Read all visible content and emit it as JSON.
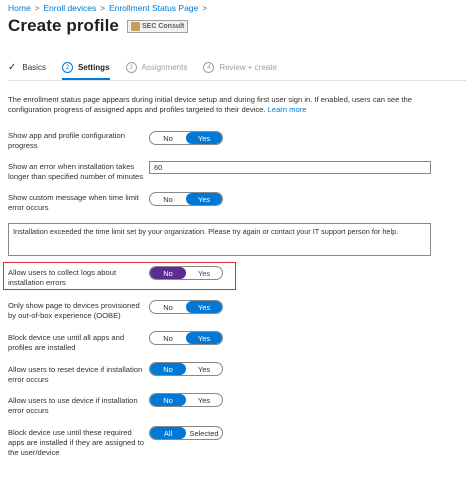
{
  "breadcrumb": [
    {
      "label": "Home"
    },
    {
      "label": "Enroll devices"
    },
    {
      "label": "Enrollment Status Page"
    }
  ],
  "header": {
    "title": "Create profile",
    "badge": "SEC Consult"
  },
  "steps": [
    {
      "label": "Basics",
      "status": "done"
    },
    {
      "num": "2",
      "label": "Settings",
      "status": "active"
    },
    {
      "num": "3",
      "label": "Assignments",
      "status": "inactive"
    },
    {
      "num": "4",
      "label": "Review + create",
      "status": "inactive"
    }
  ],
  "description": {
    "text": "The enrollment status page appears during initial device setup and during first user sign in. If enabled, users can see the configuration progress of assigned apps and profiles targeted to their device.",
    "link": "Learn more"
  },
  "settings": {
    "show_progress": {
      "label": "Show app and profile configuration progress",
      "options": [
        "No",
        "Yes"
      ],
      "selected": "Yes"
    },
    "error_timeout": {
      "label": "Show an error when installation takes longer than specified number of minutes",
      "value": "60"
    },
    "custom_message": {
      "label": "Show custom message when time limit error occurs",
      "options": [
        "No",
        "Yes"
      ],
      "selected": "Yes"
    },
    "message_text": "Installation exceeded the time limit set by your organization. Please try again or contact your IT support person for help.",
    "collect_logs": {
      "label": "Allow users to collect logs about installation errors",
      "options": [
        "No",
        "Yes"
      ],
      "selected": "No"
    },
    "oobe_only": {
      "label": "Only show page to devices provisioned by out-of-box experience (OOBE)",
      "options": [
        "No",
        "Yes"
      ],
      "selected": "Yes"
    },
    "block_until_installed": {
      "label": "Block device use until all apps and profiles are installed",
      "options": [
        "No",
        "Yes"
      ],
      "selected": "Yes"
    },
    "allow_reset": {
      "label": "Allow users to reset device if installation error occurs",
      "options": [
        "No",
        "Yes"
      ],
      "selected": "No"
    },
    "allow_use": {
      "label": "Allow users to use device if installation error occurs",
      "options": [
        "No",
        "Yes"
      ],
      "selected": "No"
    },
    "block_required_apps": {
      "label": "Block device use until these required apps are installed if they are assigned to the user/device",
      "options": [
        "All",
        "Selected"
      ],
      "selected": "All"
    }
  },
  "colors": {
    "accent": "#0078d4",
    "highlight_toggle": "#5c2d91",
    "highlight_border": "#d13438"
  }
}
